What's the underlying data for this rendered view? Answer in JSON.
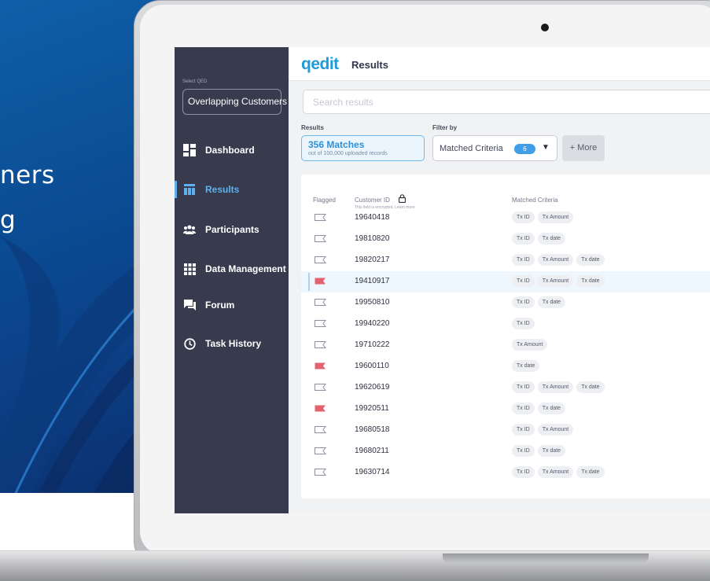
{
  "hero": {
    "line1": "ners",
    "line2": "g"
  },
  "colors": {
    "accent": "#5fb0ef",
    "brand": "#1f9bd9",
    "sidebar": "#383a4e",
    "flag_red": "#e4626f",
    "flag_outline": "#8c8e9c"
  },
  "sidebar": {
    "select_label": "Select QED",
    "selected_qed": "Overlapping Customers ▾",
    "items": [
      {
        "label": "Dashboard",
        "icon": "dashboard-icon",
        "active": false
      },
      {
        "label": "Results",
        "icon": "table-icon",
        "active": true
      },
      {
        "label": "Participants",
        "icon": "people-icon",
        "active": false
      },
      {
        "label": "Data Management",
        "icon": "grid-icon",
        "active": false
      },
      {
        "label": "Forum",
        "icon": "chat-icon",
        "active": false
      },
      {
        "label": "Task History",
        "icon": "clock-icon",
        "active": false
      }
    ]
  },
  "header": {
    "logo": "qedit",
    "title": "Results"
  },
  "search": {
    "placeholder": "Search results"
  },
  "results_summary": {
    "label": "Results",
    "matches": "356 Matches",
    "sub": "out of 100,000 uploaded records"
  },
  "filter": {
    "label": "Filter by",
    "value": "Matched Criteria",
    "count": "6",
    "caret": "▼",
    "more": "+ More"
  },
  "table": {
    "headers": {
      "flagged": "Flagged",
      "customer_id": "Customer ID",
      "note": "This field is encrypted. Learn more",
      "criteria": "Matched Criteria"
    },
    "rows": [
      {
        "flagged": false,
        "id": "19640418",
        "criteria": [
          "Tx ID",
          "Tx Amount"
        ]
      },
      {
        "flagged": false,
        "id": "19810820",
        "criteria": [
          "Tx ID",
          "Tx date"
        ]
      },
      {
        "flagged": false,
        "id": "19820217",
        "criteria": [
          "Tx ID",
          "Tx Amount",
          "Tx date"
        ]
      },
      {
        "flagged": true,
        "id": "19410917",
        "criteria": [
          "Tx ID",
          "Tx Amount",
          "Tx date"
        ],
        "highlight": true
      },
      {
        "flagged": false,
        "id": "19950810",
        "criteria": [
          "Tx ID",
          "Tx date"
        ]
      },
      {
        "flagged": false,
        "id": "19940220",
        "criteria": [
          "Tx ID"
        ]
      },
      {
        "flagged": false,
        "id": "19710222",
        "criteria": [
          "Tx Amount"
        ]
      },
      {
        "flagged": true,
        "id": "19600110",
        "criteria": [
          "Tx date"
        ]
      },
      {
        "flagged": false,
        "id": "19620619",
        "criteria": [
          "Tx ID",
          "Tx Amount",
          "Tx date"
        ]
      },
      {
        "flagged": true,
        "id": "19920511",
        "criteria": [
          "Tx ID",
          "Tx date"
        ]
      },
      {
        "flagged": false,
        "id": "19680518",
        "criteria": [
          "Tx ID",
          "Tx Amount"
        ]
      },
      {
        "flagged": false,
        "id": "19680211",
        "criteria": [
          "Tx ID",
          "Tx date"
        ]
      },
      {
        "flagged": false,
        "id": "19630714",
        "criteria": [
          "Tx ID",
          "Tx Amount",
          "Tx date"
        ]
      }
    ]
  }
}
